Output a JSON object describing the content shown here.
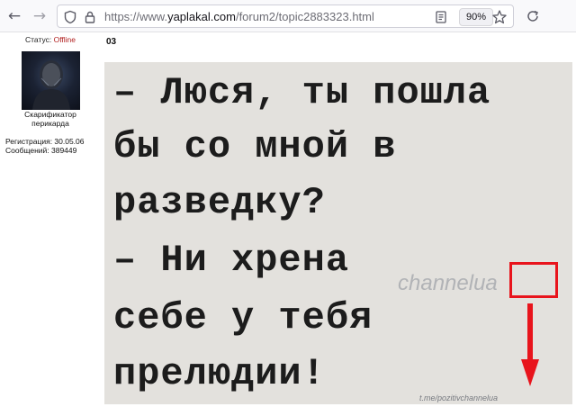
{
  "browser": {
    "url_prefix": "https://www.",
    "url_domain": "yaplakal.com",
    "url_path": "/forum2/topic2883323.html",
    "zoom": "90%"
  },
  "user": {
    "status_label": "Статус:",
    "status_value": "Offline",
    "name_line1": "Скарификатор",
    "name_line2": "перикарда",
    "registration": "Регистрация: 30.05.06",
    "messages": "Сообщений: 389449"
  },
  "post": {
    "title": "03",
    "lines": [
      "– Люся, ты пошла",
      "бы со мной в",
      "разведку?",
      "– Ни хрена",
      "себе у тебя",
      "прелюдии!"
    ],
    "watermark": "channelua",
    "watermark_url": "t.me/pozitivchannelua"
  },
  "colors": {
    "offline": "#b22222",
    "annotation_red": "#e8141c"
  }
}
